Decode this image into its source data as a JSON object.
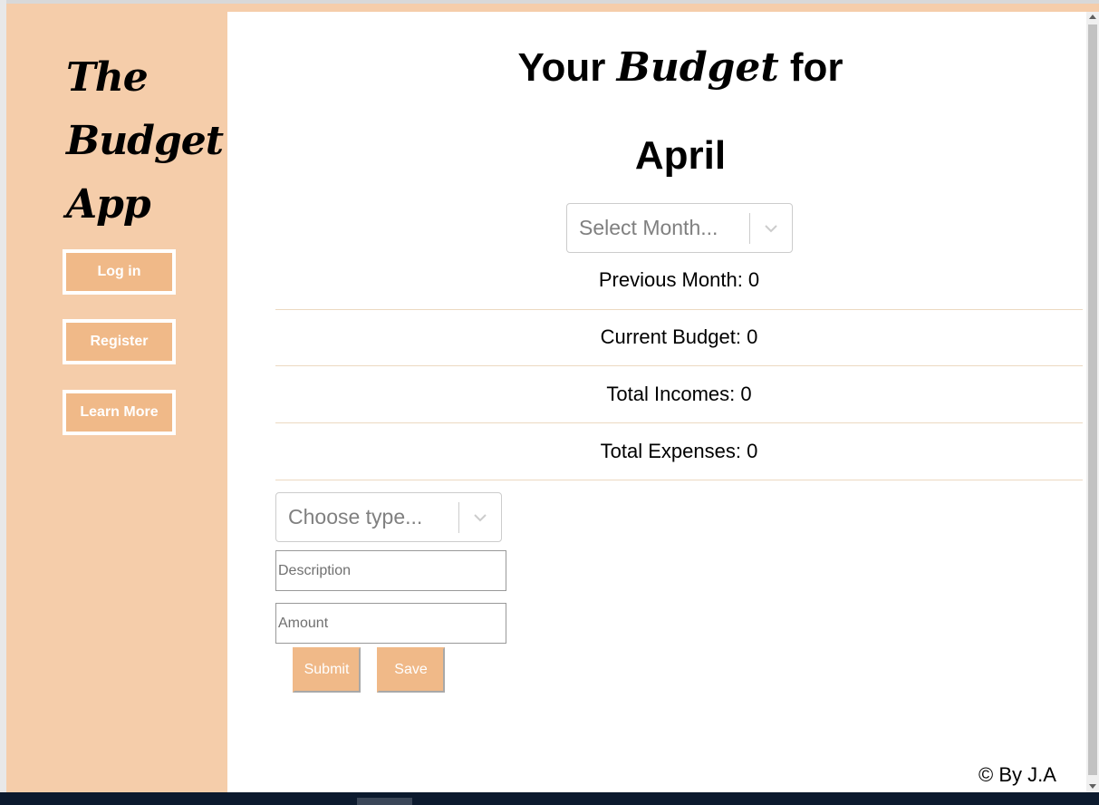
{
  "sidebar": {
    "brand_lines": [
      "The",
      "Budget",
      "App"
    ],
    "buttons": [
      {
        "label": "Log in"
      },
      {
        "label": "Register"
      },
      {
        "label": "Learn More"
      }
    ]
  },
  "header": {
    "title_prefix": "Your",
    "title_script": "Budget",
    "title_suffix": "for",
    "month": "April"
  },
  "month_select": {
    "placeholder": "Select Month..."
  },
  "stats": [
    {
      "text": "Previous Month: 0"
    },
    {
      "text": "Current Budget: 0"
    },
    {
      "text": "Total Incomes:  0"
    },
    {
      "text": "Total Expenses:  0"
    }
  ],
  "form": {
    "type_select_placeholder": "Choose type...",
    "description_placeholder": "Description",
    "amount_placeholder": "Amount",
    "submit_label": "Submit",
    "save_label": "Save"
  },
  "footer": {
    "text": "© By J.A"
  },
  "colors": {
    "sidebar_bg": "#f5cdaa",
    "button_bg": "#f0b988",
    "divider": "#ecd9c1"
  },
  "icons": {
    "select_indicator": "chevron-down-icon"
  }
}
